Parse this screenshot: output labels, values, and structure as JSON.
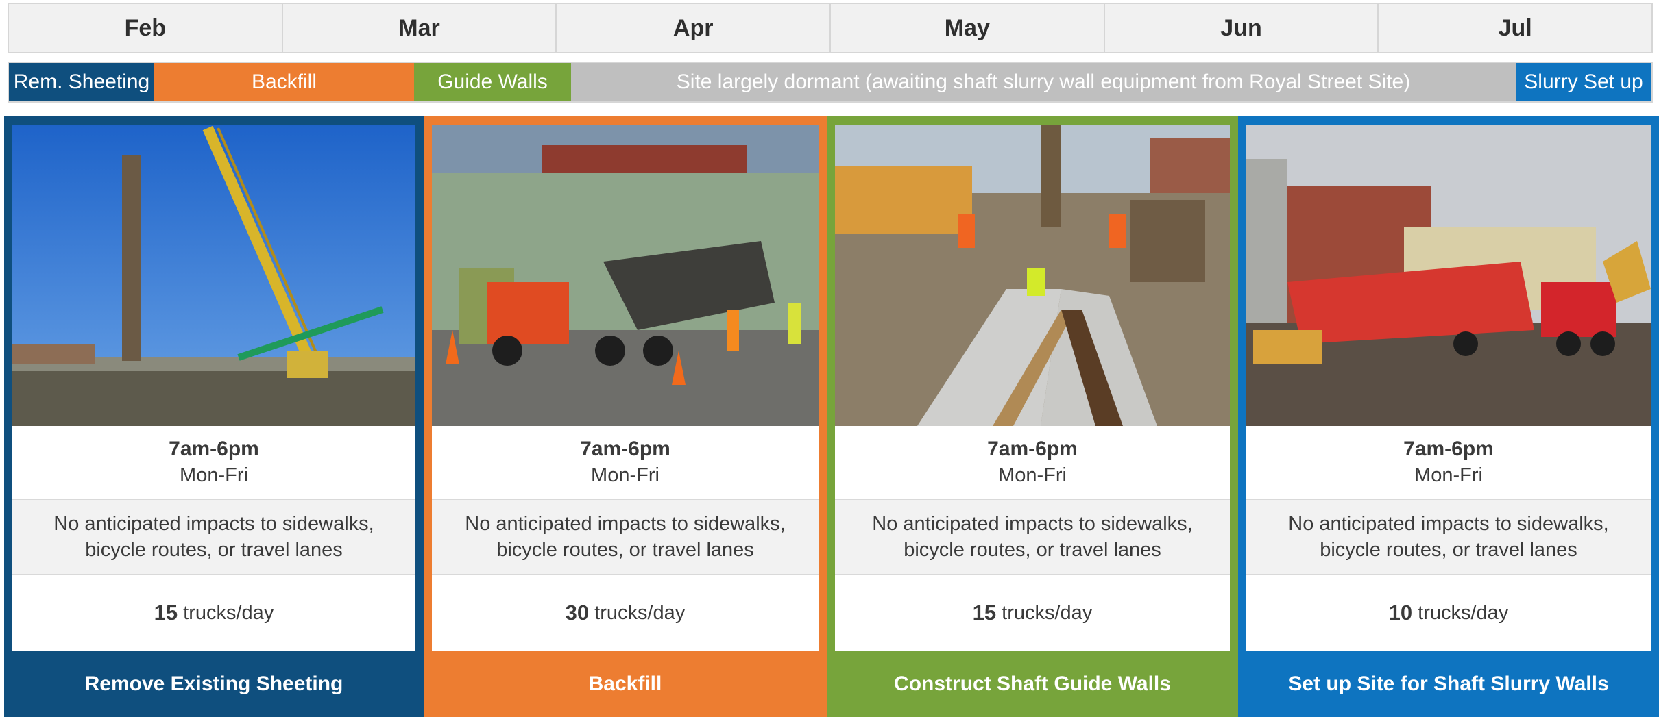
{
  "timeline": {
    "months": [
      "Feb",
      "Mar",
      "Apr",
      "May",
      "Jun",
      "Jul"
    ]
  },
  "phases": [
    {
      "label": "Rem. Sheeting",
      "color": "#0f4f7e"
    },
    {
      "label": "Backfill",
      "color": "#ed7d31"
    },
    {
      "label": "Guide Walls",
      "color": "#77a43b"
    },
    {
      "label": "Site largely dormant (awaiting shaft slurry wall equipment from Royal Street Site)",
      "color": "#bfbfbf"
    },
    {
      "label": "Slurry Set up",
      "color": "#0e74c0"
    }
  ],
  "cards": [
    {
      "photo_icon": "crane-photo",
      "hours": "7am-6pm",
      "days": "Mon-Fri",
      "impact_line1": "No anticipated impacts to sidewalks,",
      "impact_line2": "bicycle routes, or travel lanes",
      "trucks_count": "15",
      "trucks_unit": "trucks/day",
      "caption": "Remove Existing Sheeting",
      "color": "#0f4f7e"
    },
    {
      "photo_icon": "dump-truck-photo",
      "hours": "7am-6pm",
      "days": "Mon-Fri",
      "impact_line1": "No anticipated impacts to sidewalks,",
      "impact_line2": "bicycle routes, or travel lanes",
      "trucks_count": "30",
      "trucks_unit": "trucks/day",
      "caption": "Backfill",
      "color": "#ed7d31"
    },
    {
      "photo_icon": "guide-wall-trench-photo",
      "hours": "7am-6pm",
      "days": "Mon-Fri",
      "impact_line1": "No anticipated impacts to sidewalks,",
      "impact_line2": "bicycle routes, or travel lanes",
      "trucks_count": "15",
      "trucks_unit": "trucks/day",
      "caption": "Construct Shaft Guide Walls",
      "color": "#77a43b"
    },
    {
      "photo_icon": "red-trailer-photo",
      "hours": "7am-6pm",
      "days": "Mon-Fri",
      "impact_line1": "No anticipated impacts to sidewalks,",
      "impact_line2": "bicycle routes, or travel lanes",
      "trucks_count": "10",
      "trucks_unit": "trucks/day",
      "caption": "Set up Site for Shaft Slurry Walls",
      "color": "#0e74c0"
    }
  ]
}
